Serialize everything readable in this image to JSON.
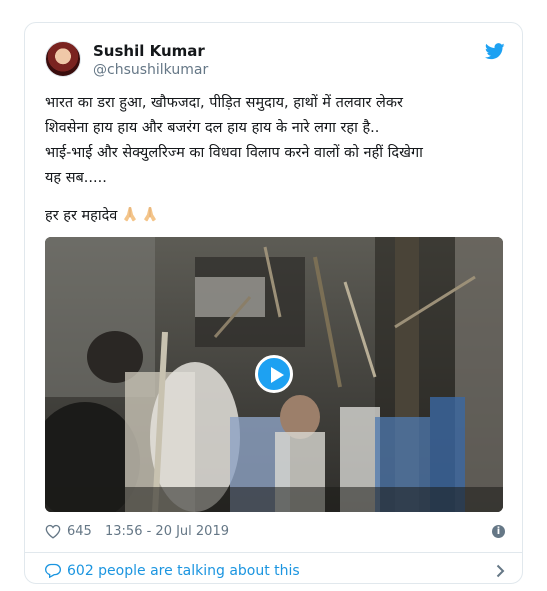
{
  "author": {
    "name": "Sushil Kumar",
    "handle": "@chsushilkumar"
  },
  "brand_color": "#1da1f2",
  "tweet": {
    "lines": [
      "भारत का डरा हुआ, खौफजदा, पीड़ित समुदाय, हाथों में तलवार लेकर",
      "शिवसेना हाय हाय और बजरंग दल हाय हाय के नारे लगा रहा है..",
      "भाई-भाई और सेक्युलरिज्म का विधवा विलाप करने वालों को नहीं दिखेगा",
      "यह सब.....",
      "हर हर महादेव"
    ],
    "emojis": [
      "folded-hands-emoji",
      "folded-hands-emoji"
    ]
  },
  "media": {
    "type": "video",
    "play_icon": "play-icon"
  },
  "meta": {
    "likes": "645",
    "timestamp": "13:56 - 20 Jul 2019",
    "info_icon": "info-icon"
  },
  "footer": {
    "talk_text": "602 people are talking about this"
  },
  "icons": {
    "bird": "twitter-bird-icon",
    "heart": "heart-icon",
    "comment": "comment-bubble-icon",
    "chevron": "chevron-right-icon"
  }
}
